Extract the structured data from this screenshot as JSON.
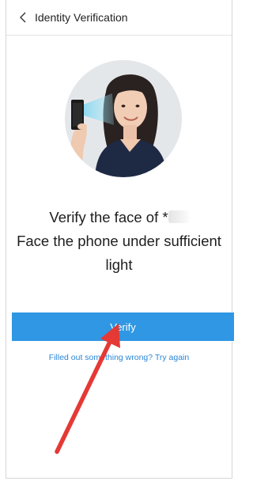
{
  "header": {
    "title": "Identity Verification",
    "back_icon": "chevron-left-icon"
  },
  "avatar": {
    "image": "face-scan-illustration"
  },
  "message": {
    "line1_prefix": "Verify the face of *",
    "line2": "Face the phone under sufficient",
    "line3": "light"
  },
  "actions": {
    "verify_label": "Verify",
    "retry_label": "Filled out something wrong? Try again"
  },
  "colors": {
    "primary": "#2f97e3",
    "link": "#2a86d8",
    "annotation_arrow": "#e53935"
  }
}
